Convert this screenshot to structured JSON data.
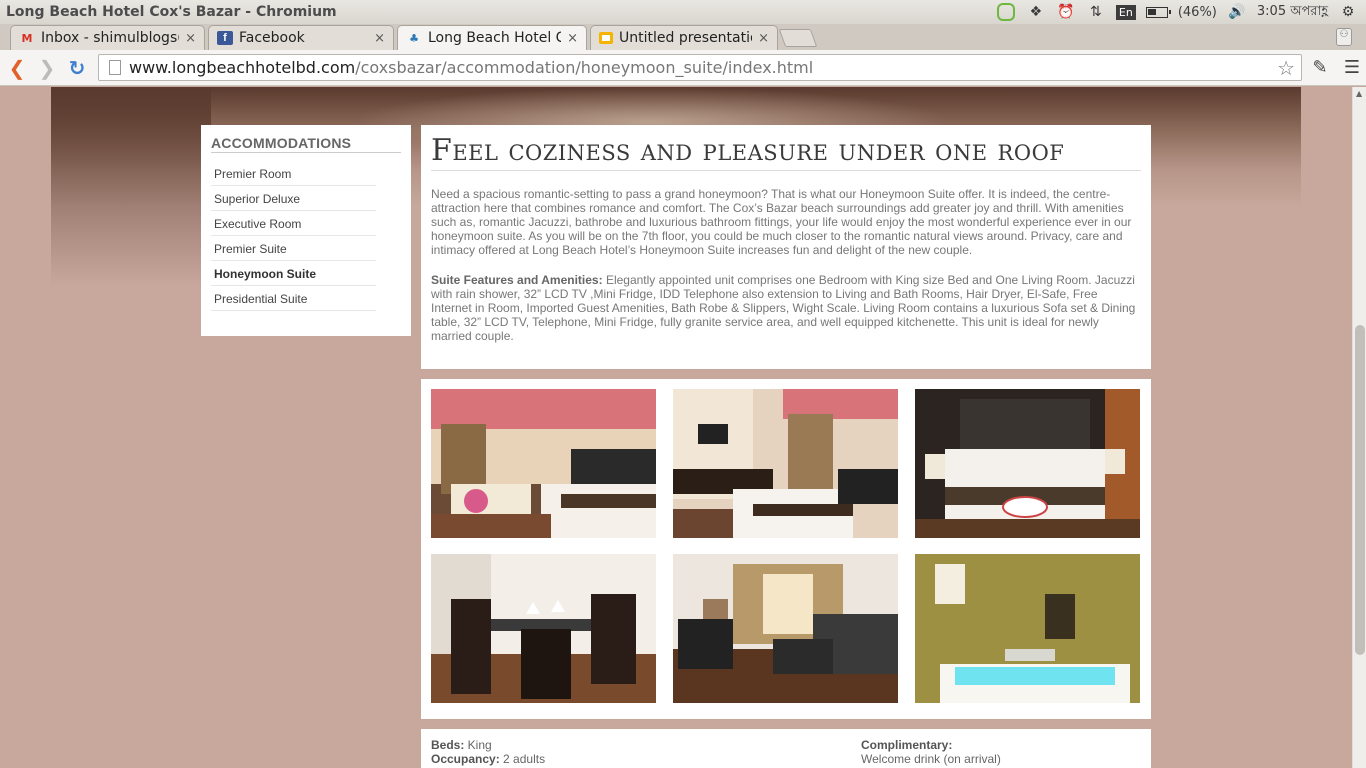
{
  "os": {
    "window_title": "Long Beach Hotel Cox's Bazar - Chromium",
    "keyboard_layout": "En",
    "battery": "(46%)",
    "clock": "3:05 অপরাহ্ণ"
  },
  "tabs": [
    {
      "label": "Inbox - shimulblogs(",
      "icon": "gmail-icon",
      "close": "×"
    },
    {
      "label": "Facebook",
      "icon": "facebook-icon",
      "close": "×"
    },
    {
      "label": "Long Beach Hotel Co",
      "icon": "hotel-lotus-icon",
      "close": "×"
    },
    {
      "label": "Untitled presentatio",
      "icon": "slides-icon",
      "close": "×"
    }
  ],
  "toolbar": {
    "url_host": "www.longbeachhotelbd.com",
    "url_path": "/coxsbazar/accommodation/honeymoon_suite/index.html"
  },
  "sidebar": {
    "heading": "ACCOMMODATIONS",
    "items": [
      {
        "label": "Premier Room"
      },
      {
        "label": "Superior Deluxe"
      },
      {
        "label": "Executive Room"
      },
      {
        "label": "Premier Suite"
      },
      {
        "label": "Honeymoon Suite",
        "active": true
      },
      {
        "label": "Presidential Suite"
      }
    ]
  },
  "main": {
    "title": "Feel coziness and pleasure under one roof",
    "intro": "Need a spacious romantic-setting to pass a grand honeymoon? That is what our Honeymoon Suite offer. It is indeed, the centre-attraction here that combines romance and comfort. The Cox’s Bazar beach surroundings add greater joy and thrill. With amenities such as, romantic Jacuzzi, bathrobe and luxurious bathroom fittings, your life would enjoy the most wonderful experience ever in our honeymoon suite. As you will be on the 7th floor, you could be much closer to the romantic natural views around. Privacy, care and intimacy offered at Long Beach Hotel’s Honeymoon Suite increases fun and delight of the new couple.",
    "features_label": "Suite Features and Amenities:",
    "features_text": " Elegantly appointed unit comprises one Bedroom with King size Bed and One Living Room. Jacuzzi with rain shower, 32” LCD TV ,Mini Fridge, IDD Telephone also extension to Living and Bath Rooms, Hair Dryer, El-Safe, Free Internet in Room, Imported Guest Amenities, Bath Robe & Slippers, Wight Scale. Living Room contains a luxurious Sofa set & Dining table, 32” LCD TV, Telephone, Mini Fridge, fully granite service area, and well equipped kitchenette. This unit is ideal for newly married couple."
  },
  "details": {
    "beds_label": "Beds:",
    "beds_value": " King",
    "occupancy_label": "Occupancy:",
    "occupancy_value": " 2 adults",
    "complimentary_label": "Complimentary:",
    "complimentary_value": "Welcome drink (on arrival)"
  },
  "colors": {
    "page_bg": "#c8a89c",
    "panel_bg": "#ffffff",
    "text": "#777777"
  }
}
